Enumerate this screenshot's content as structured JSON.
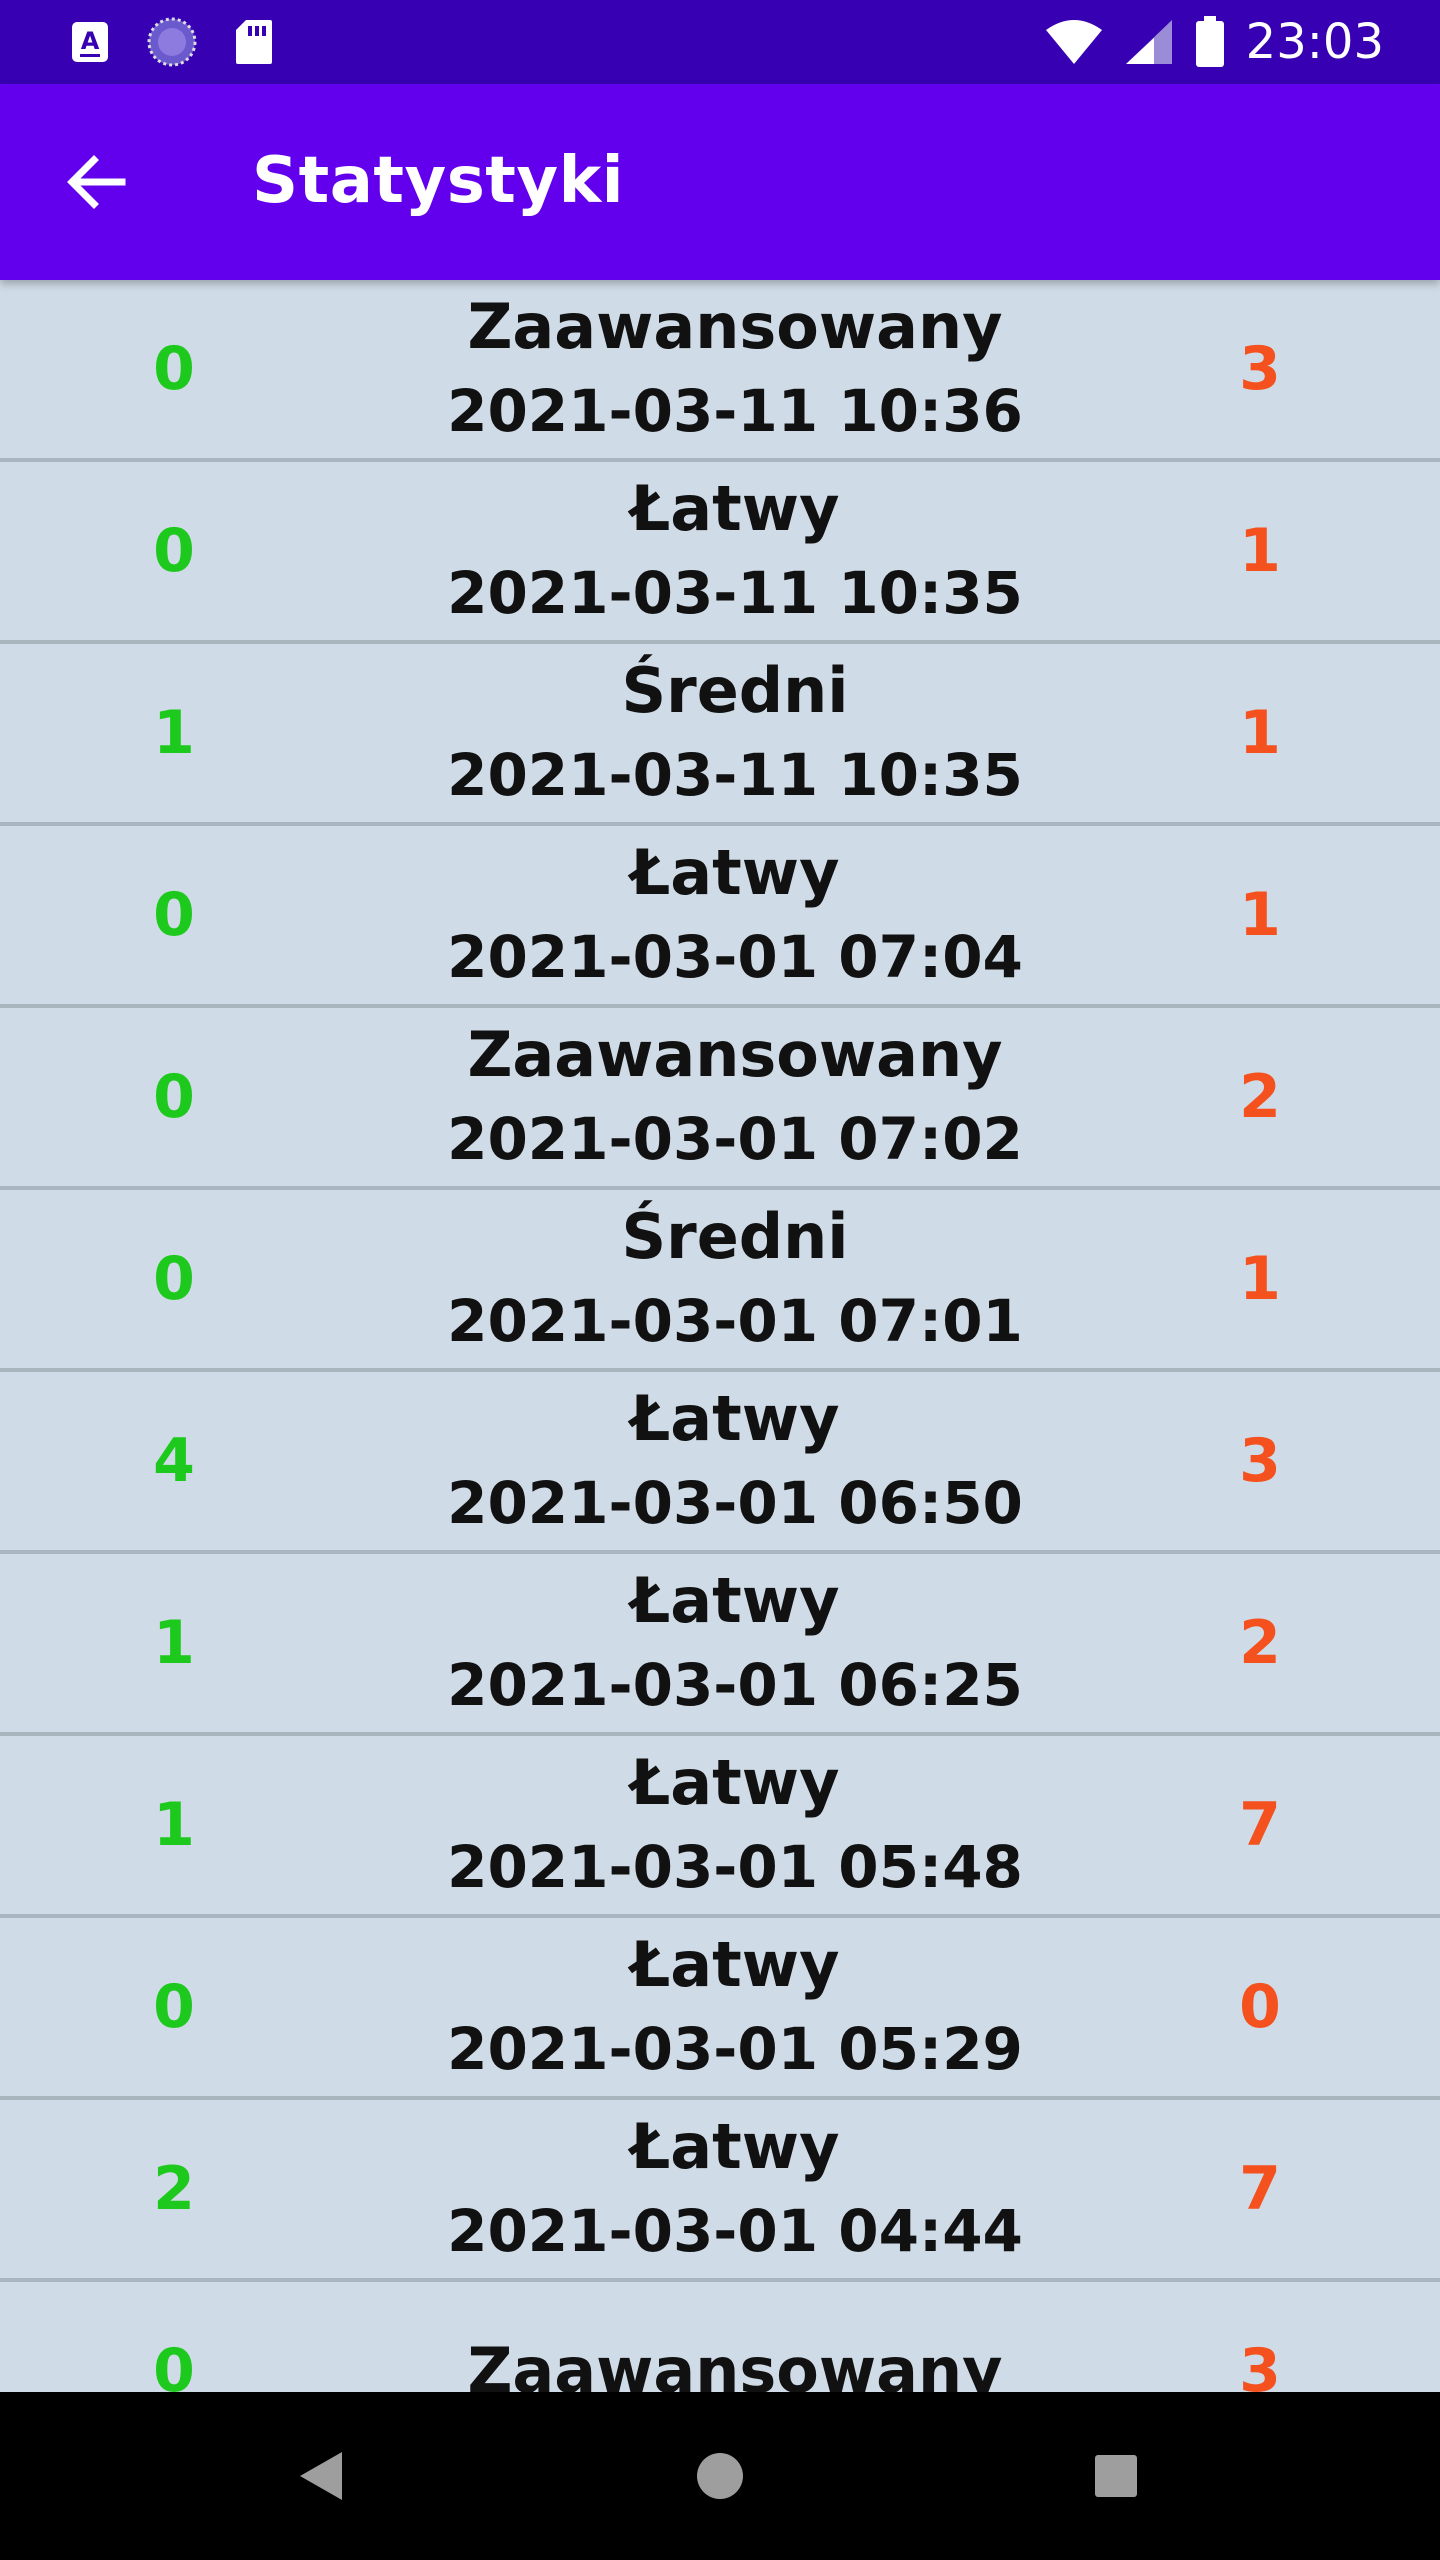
{
  "status_bar": {
    "time": "23:03",
    "icons_left": [
      "font-a-icon",
      "sync-icon",
      "sd-card-icon"
    ],
    "icons_right": [
      "wifi-icon",
      "signal-icon",
      "battery-icon"
    ]
  },
  "app_bar": {
    "title": "Statystyki",
    "back_icon": "arrow-back-icon",
    "color": "#6200ee"
  },
  "colors": {
    "correct": "#1ec91e",
    "wrong": "#f4511e",
    "row_bg": "#cfdbe6",
    "status_bar": "#3700b3"
  },
  "rows": [
    {
      "left": "0",
      "level": "Zaawansowany",
      "date": "2021-03-11 10:36",
      "right": "3"
    },
    {
      "left": "0",
      "level": "Łatwy",
      "date": "2021-03-11 10:35",
      "right": "1"
    },
    {
      "left": "1",
      "level": "Średni",
      "date": "2021-03-11 10:35",
      "right": "1"
    },
    {
      "left": "0",
      "level": "Łatwy",
      "date": "2021-03-01 07:04",
      "right": "1"
    },
    {
      "left": "0",
      "level": "Zaawansowany",
      "date": "2021-03-01 07:02",
      "right": "2"
    },
    {
      "left": "0",
      "level": "Średni",
      "date": "2021-03-01 07:01",
      "right": "1"
    },
    {
      "left": "4",
      "level": "Łatwy",
      "date": "2021-03-01 06:50",
      "right": "3"
    },
    {
      "left": "1",
      "level": "Łatwy",
      "date": "2021-03-01 06:25",
      "right": "2"
    },
    {
      "left": "1",
      "level": "Łatwy",
      "date": "2021-03-01 05:48",
      "right": "7"
    },
    {
      "left": "0",
      "level": "Łatwy",
      "date": "2021-03-01 05:29",
      "right": "0"
    },
    {
      "left": "2",
      "level": "Łatwy",
      "date": "2021-03-01 04:44",
      "right": "7"
    },
    {
      "left": "0",
      "level": "Zaawansowany",
      "date": "",
      "right": "3"
    }
  ],
  "nav_bar": {
    "buttons": [
      "back-nav-icon",
      "home-nav-icon",
      "recents-nav-icon"
    ]
  }
}
